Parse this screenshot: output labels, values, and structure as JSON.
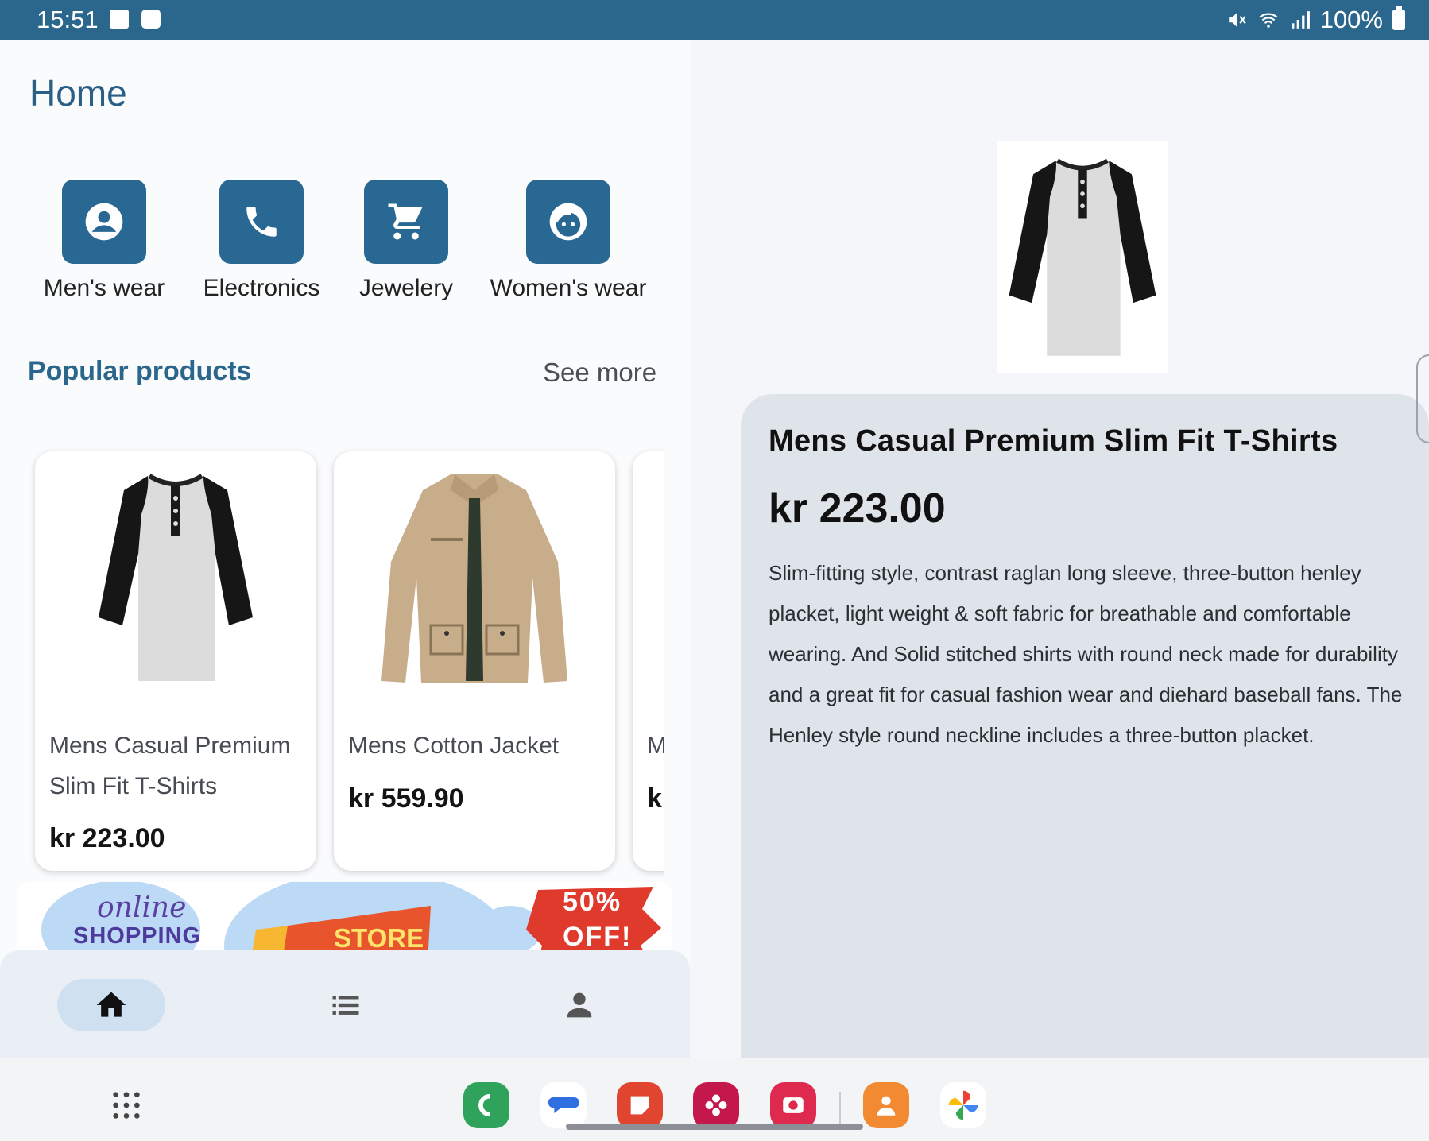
{
  "status_bar": {
    "time": "15:51",
    "battery": "100%"
  },
  "home": {
    "title": "Home",
    "categories": [
      {
        "label": "Men's wear",
        "icon": "account-circle-icon"
      },
      {
        "label": "Electronics",
        "icon": "phone-icon"
      },
      {
        "label": "Jewelery",
        "icon": "cart-icon"
      },
      {
        "label": "Women's wear",
        "icon": "face-icon"
      }
    ],
    "popular": {
      "title": "Popular products",
      "see_more": "See more",
      "products": [
        {
          "name": "Mens Casual Premium Slim Fit T-Shirts",
          "price": "kr 223.00"
        },
        {
          "name": "Mens Cotton Jacket",
          "price": "kr 559.90"
        },
        {
          "name": "M",
          "price": "k"
        }
      ]
    },
    "banner": {
      "line1": "online",
      "line2": "SHOPPING",
      "store": "STORE",
      "discount1": "50%",
      "discount2": "OFF!"
    }
  },
  "bottom_nav": [
    {
      "name": "home",
      "icon": "home-icon",
      "active": true
    },
    {
      "name": "list",
      "icon": "list-icon",
      "active": false
    },
    {
      "name": "profile",
      "icon": "person-icon",
      "active": false
    }
  ],
  "detail": {
    "title": "Mens Casual Premium Slim Fit T-Shirts",
    "price": "kr 223.00",
    "description": "Slim-fitting style, contrast raglan long sleeve, three-button henley placket, light weight & soft fabric for breathable and comfortable wearing. And Solid stitched shirts with round neck made for durability and a great fit for casual fashion wear and diehard baseball fans. The Henley style round neckline includes a three-button placket."
  },
  "dock": {
    "apps": [
      "app-drawer-icon",
      "phone-app-icon",
      "messages-app-icon",
      "notes-app-icon",
      "blossom-app-icon",
      "camera-app-icon",
      "contacts-app-icon",
      "photos-app-icon"
    ]
  },
  "colors": {
    "primary": "#2b668c",
    "status_bar": "#2b668c",
    "sheet": "#dfe3ea",
    "nav_active": "#cfe1f1"
  }
}
